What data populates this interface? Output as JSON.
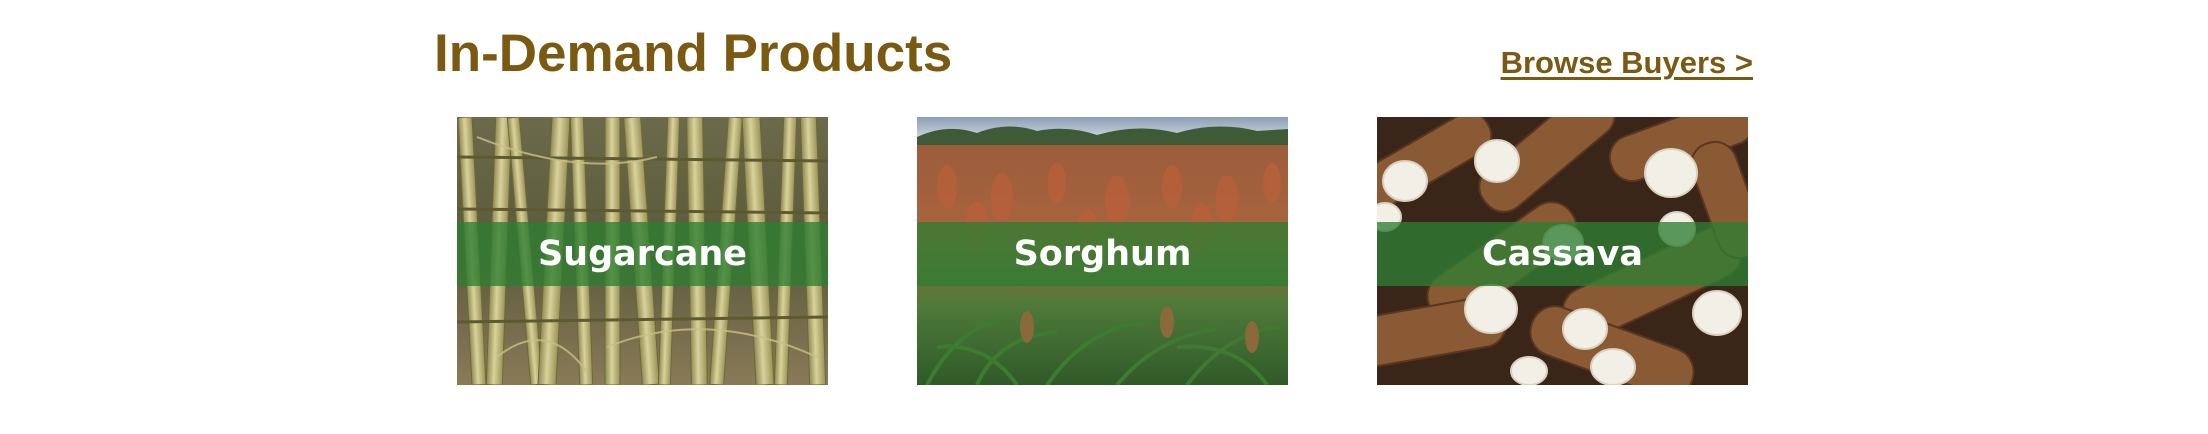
{
  "section": {
    "title": "In-Demand Products",
    "browse_link": "Browse Buyers >"
  },
  "products": [
    {
      "label": "Sugarcane"
    },
    {
      "label": "Sorghum"
    },
    {
      "label": "Cassava"
    }
  ],
  "colors": {
    "heading": "#7a5a12",
    "label_band": "#2e7d32",
    "label_text": "#ffffff"
  }
}
